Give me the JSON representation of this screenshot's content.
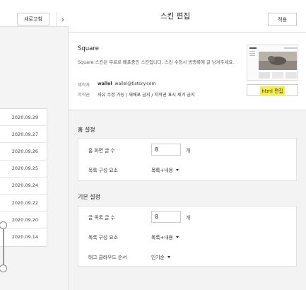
{
  "left": {
    "refresh_label": "새로고침",
    "collapse_glyph": "›",
    "dates": [
      "2020.09.29",
      "2020.09.27",
      "2020.09.26",
      "2020.09.25",
      "2020.09.24",
      "2020.09.22",
      "2020.09.20",
      "2020.09.14"
    ]
  },
  "header": {
    "title": "스킨 편집",
    "apply_label": "적용"
  },
  "skin": {
    "name": "Square",
    "description": "Square 스킨은 무료로 배포중인 스킨입니다. 스킨 수정시 방명록에 글 남겨주세요.",
    "author_key": "제작자",
    "author_name": "wallel",
    "author_email": "wallel@tistory.com",
    "copyright_key": "저작권",
    "copyright_value": "자유 수정 가능 / 재배포 금지 / 저작권 표시 제거 금지",
    "html_edit_label": "html 편집"
  },
  "home_settings": {
    "title": "홈 설정",
    "rows": [
      {
        "label": "홈 화면 글 수",
        "value": "8",
        "unit": "개"
      },
      {
        "label": "목록 구성 요소",
        "select": "목록+내용"
      }
    ]
  },
  "basic_settings": {
    "title": "기본 설정",
    "rows": [
      {
        "label": "글 목록 글 수",
        "value": "8",
        "unit": "개"
      },
      {
        "label": "목록 구성 요소",
        "select": "목록+내용"
      },
      {
        "label": "태그 클라우드 순서",
        "select": "인기순"
      }
    ]
  }
}
